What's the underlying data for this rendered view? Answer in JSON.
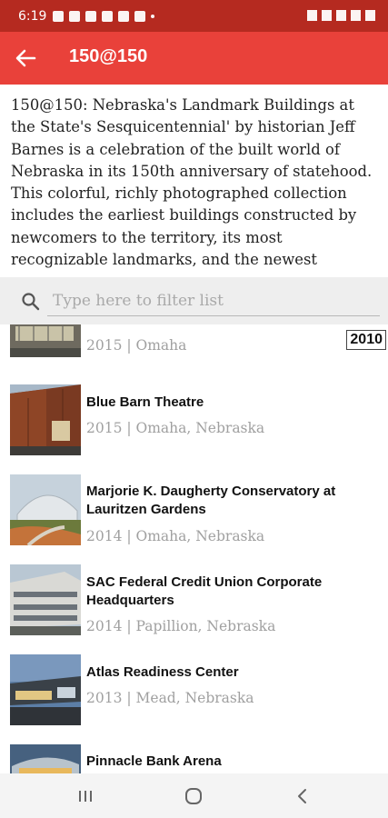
{
  "status_bar": {
    "time": "6:19"
  },
  "app_bar": {
    "title": "150@150"
  },
  "description": "150@150: Nebraska's Landmark Buildings at the State's Sesquicentennial' by historian Jeff Barnes is a celebration of the built world of Nebraska in its 150th anniversary of statehood. This colorful, richly photographed collection includes the earliest buildings constructed by newcomers to the territory, its most recognizable landmarks, and the newest",
  "filter": {
    "placeholder": "Type here to filter list"
  },
  "year_badge": "2010",
  "list": [
    {
      "name": "",
      "meta": "2015 | Omaha"
    },
    {
      "name": "Blue Barn Theatre",
      "meta": "2015 | Omaha, Nebraska"
    },
    {
      "name": "Marjorie K. Daugherty Conservatory at Lauritzen Gardens",
      "meta": "2014 | Omaha, Nebraska"
    },
    {
      "name": "SAC Federal Credit Union Corporate Headquarters",
      "meta": "2014 | Papillion, Nebraska"
    },
    {
      "name": "Atlas Readiness Center",
      "meta": "2013 | Mead, Nebraska"
    },
    {
      "name": "Pinnacle Bank Arena",
      "meta": ""
    }
  ],
  "colors": {
    "status_bar": "#b52a20",
    "app_bar": "#e9413a",
    "filter_bg": "#eeeeee",
    "meta_text": "#a0a0a0"
  }
}
